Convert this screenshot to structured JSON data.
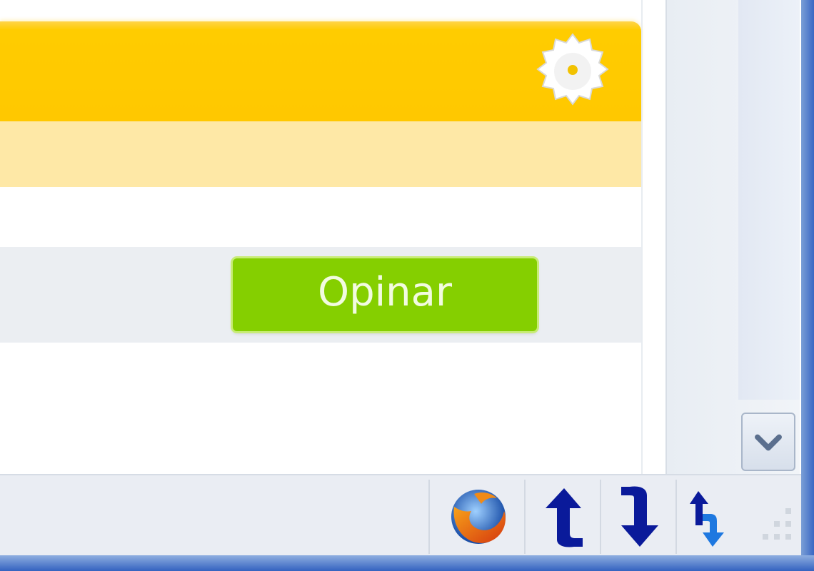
{
  "colors": {
    "header_accent": "#ffcc00",
    "header_band": "#fee8a6",
    "button_green": "#85cf00",
    "window_frame": "#3a67c4"
  },
  "header": {
    "settings_icon": "gear-icon"
  },
  "feedback": {
    "button_label": "Opinar"
  },
  "scrollbar": {
    "down_icon": "chevron-down-icon"
  },
  "statusbar": {
    "icons": [
      "firefox-icon",
      "upload-arrow-icon",
      "download-arrow-icon",
      "sync-arrows-icon"
    ]
  }
}
